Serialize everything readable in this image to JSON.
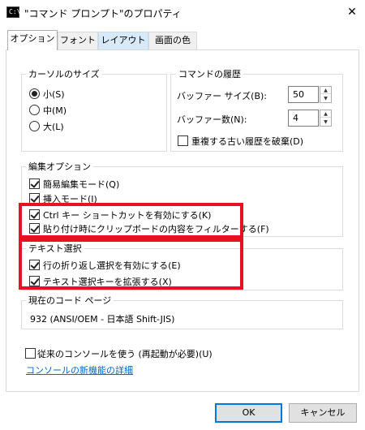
{
  "window": {
    "title": "\"コマンド プロンプト\"のプロパティ",
    "icon_text": "C:\\",
    "close_glyph": "✕"
  },
  "tabs": [
    {
      "label": "オプション",
      "active": true
    },
    {
      "label": "フォント"
    },
    {
      "label": "レイアウト"
    },
    {
      "label": "画面の色"
    }
  ],
  "cursor_size": {
    "title": "カーソルのサイズ",
    "options": [
      {
        "label": "小(S)",
        "checked": true
      },
      {
        "label": "中(M)"
      },
      {
        "label": "大(L)"
      }
    ]
  },
  "command_history": {
    "title": "コマンドの履歴",
    "buffer_size": {
      "label": "バッファー サイズ(B):",
      "value": "50"
    },
    "buffer_count": {
      "label": "バッファー数(N):",
      "value": "4"
    },
    "discard_duplicates": {
      "label": "重複する古い履歴を破棄(D)",
      "checked": false
    }
  },
  "edit_options": {
    "title": "編集オプション",
    "items": [
      {
        "label": "簡易編集モード(Q)",
        "checked": true
      },
      {
        "label": "挿入モード(I)",
        "checked": true
      },
      {
        "label": "Ctrl キー ショートカットを有効にする(K)",
        "checked": true
      },
      {
        "label": "貼り付け時にクリップボードの内容をフィルターする(F)",
        "checked": true
      }
    ]
  },
  "text_selection": {
    "title": "テキスト選択",
    "items": [
      {
        "label": "行の折り返し選択を有効にする(E)",
        "checked": true
      },
      {
        "label": "テキスト選択キーを拡張する(X)",
        "checked": true
      }
    ]
  },
  "codepage": {
    "title": "現在のコード ページ",
    "value": "932   (ANSI/OEM - 日本語 Shift-JIS)"
  },
  "legacy_console": {
    "label": "従来のコンソールを使う (再起動が必要)(U)",
    "checked": false
  },
  "link": {
    "label": "コンソールの新機能の詳細"
  },
  "buttons": {
    "ok": "OK",
    "cancel": "キャンセル"
  },
  "colors": {
    "highlight": "#e81123",
    "link": "#0066cc",
    "default_button": "#0078d7"
  }
}
